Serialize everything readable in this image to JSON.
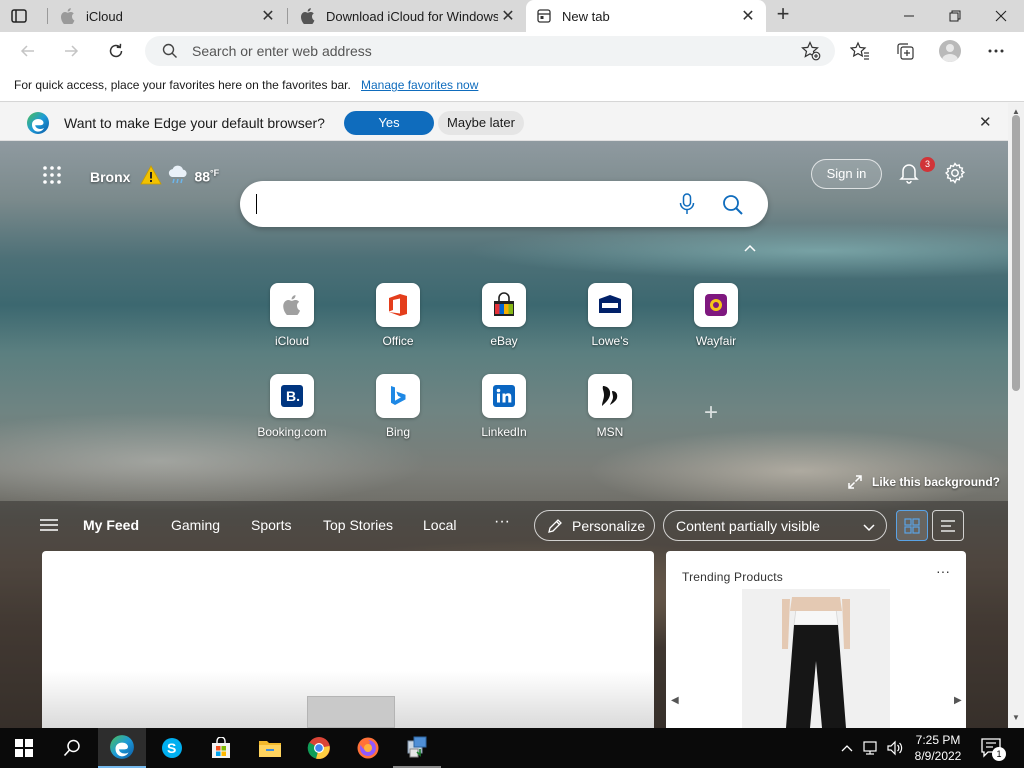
{
  "tabs": [
    {
      "title": "iCloud",
      "favicon": "apple-icon",
      "active": false
    },
    {
      "title": "Download iCloud for Windows -",
      "favicon": "apple-icon",
      "active": false
    },
    {
      "title": "New tab",
      "favicon": "new-tab-page-icon",
      "active": true
    }
  ],
  "address_bar": {
    "placeholder": "Search or enter web address",
    "value": ""
  },
  "favorites_bar": {
    "message": "For quick access, place your favorites here on the favorites bar.",
    "link": "Manage favorites now"
  },
  "infobar": {
    "message": "Want to make Edge your default browser?",
    "yes": "Yes",
    "later": "Maybe later"
  },
  "ntp": {
    "weather": {
      "city": "Bronx",
      "temp": "88",
      "unit": "°F",
      "alert": "warning-icon"
    },
    "sign_in": "Sign in",
    "notification_count": "3",
    "search_value": "",
    "quick_links": [
      {
        "label": "iCloud",
        "icon": "apple-icon"
      },
      {
        "label": "Office",
        "icon": "office-icon"
      },
      {
        "label": "eBay",
        "icon": "ebay-icon"
      },
      {
        "label": "Lowe's",
        "icon": "lowes-icon"
      },
      {
        "label": "Wayfair",
        "icon": "wayfair-icon"
      },
      {
        "label": "Booking.com",
        "icon": "booking-icon"
      },
      {
        "label": "Bing",
        "icon": "bing-icon"
      },
      {
        "label": "LinkedIn",
        "icon": "linkedin-icon"
      },
      {
        "label": "MSN",
        "icon": "msn-icon"
      }
    ],
    "like_background": "Like this background?",
    "feed_tabs": [
      "My Feed",
      "Gaming",
      "Sports",
      "Top Stories",
      "Local"
    ],
    "personalize": "Personalize",
    "content_visibility": "Content partially visible",
    "trending": {
      "title": "Trending Products"
    }
  },
  "taskbar": {
    "time": "7:25 PM",
    "date": "8/9/2022",
    "notification_count": "1",
    "apps": [
      "start",
      "search",
      "edge",
      "skype",
      "store",
      "file-explorer",
      "chrome",
      "firefox",
      "installer"
    ]
  },
  "colors": {
    "accent": "#0f6cbd",
    "edge_blue": "#0c59a4",
    "edge_green": "#4fbf53"
  }
}
